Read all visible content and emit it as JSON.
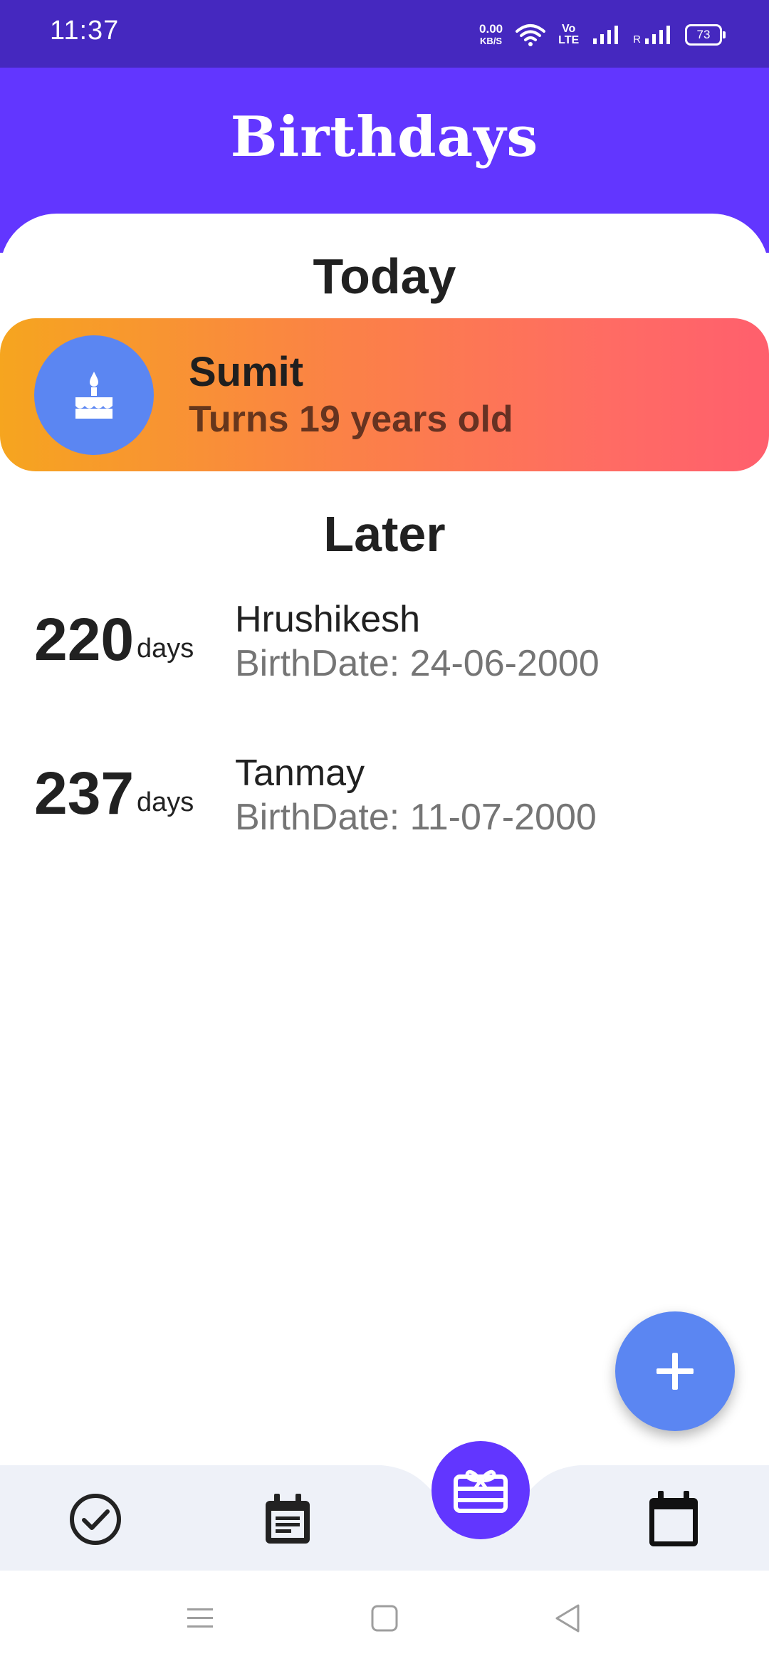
{
  "status_bar": {
    "time": "11:37",
    "speed_value": "0.00",
    "speed_unit": "KB/S",
    "volte_top": "Vo",
    "volte_bottom": "LTE",
    "roaming": "R",
    "battery": "73"
  },
  "header": {
    "title": "Birthdays"
  },
  "today": {
    "section_title": "Today",
    "card": {
      "icon": "cake-icon",
      "name": "Sumit",
      "subtitle": "Turns 19 years old"
    }
  },
  "later": {
    "section_title": "Later",
    "items": [
      {
        "days": "220",
        "unit": "days",
        "name": "Hrushikesh",
        "birthdate": "BirthDate: 24-06-2000"
      },
      {
        "days": "237",
        "unit": "days",
        "name": "Tanmay",
        "birthdate": "BirthDate: 11-07-2000"
      }
    ]
  },
  "fab": {
    "icon": "plus-icon"
  },
  "bottom_nav": {
    "items": [
      {
        "icon": "check-circle-icon"
      },
      {
        "icon": "event-note-icon"
      },
      {
        "icon": "gift-card-icon",
        "active": true
      },
      {
        "icon": "calendar-icon"
      }
    ]
  },
  "colors": {
    "status_bar": "#4528bf",
    "header": "#6236ff",
    "accent_blue": "#5b86f2",
    "card_gradient_start": "#f6a51f",
    "card_gradient_end": "#ff5f6d",
    "nav_bg": "#eef1f8"
  }
}
